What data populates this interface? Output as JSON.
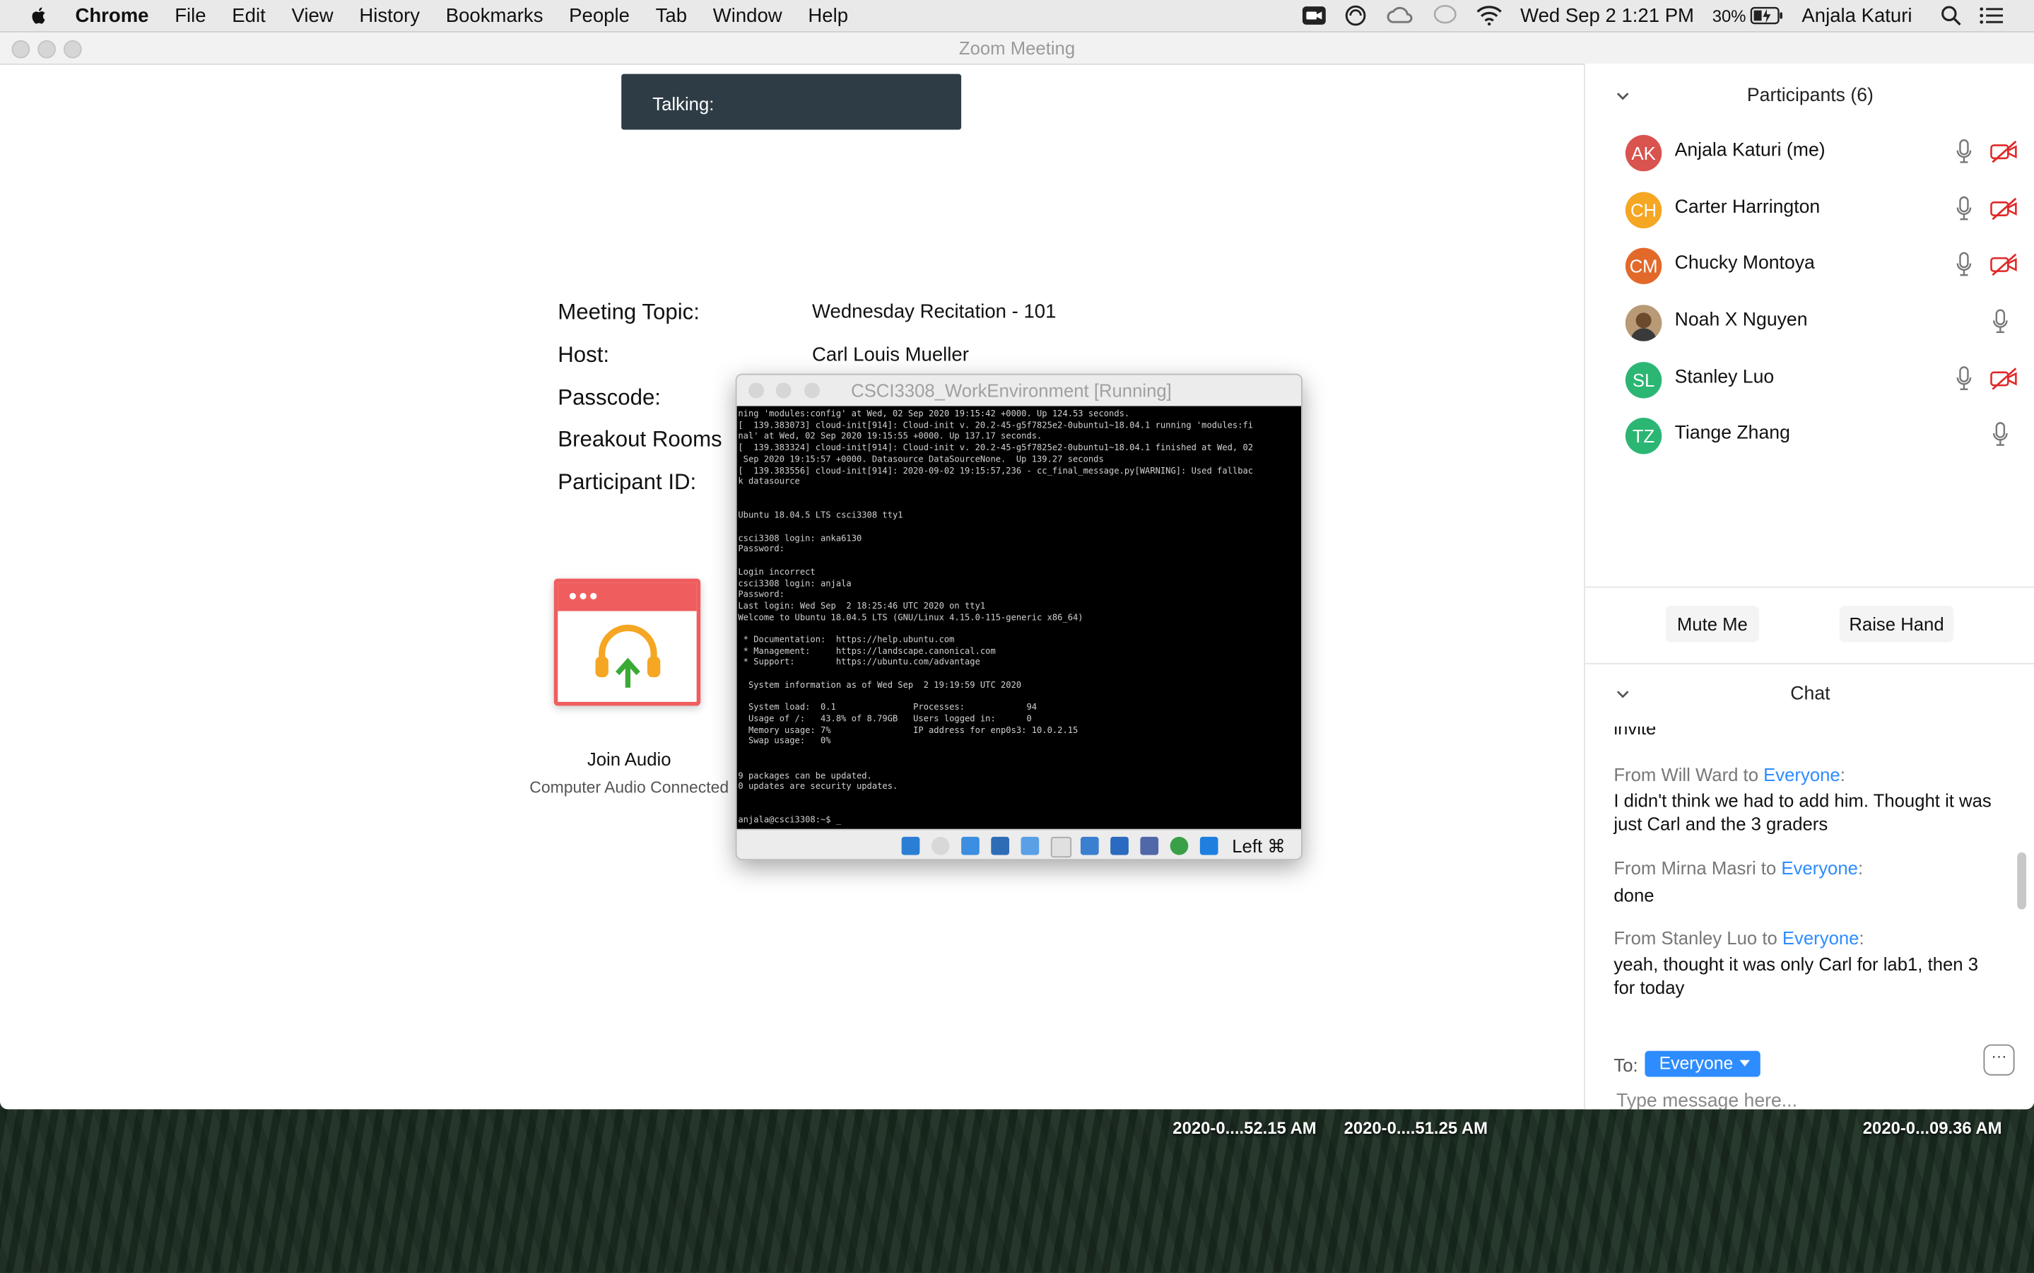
{
  "menubar": {
    "app": "Chrome",
    "items": [
      "File",
      "Edit",
      "View",
      "History",
      "Bookmarks",
      "People",
      "Tab",
      "Window",
      "Help"
    ],
    "datetime": "Wed Sep 2  1:21 PM",
    "battery": "30%",
    "user": "Anjala Katuri"
  },
  "window": {
    "title": "Zoom Meeting"
  },
  "talking": "Talking:",
  "meeting": {
    "topic_label": "Meeting Topic:",
    "topic": "Wednesday Recitation - 101",
    "host_label": "Host:",
    "host": "Carl Louis Mueller",
    "passcode_label": "Passcode:",
    "breakout_label": "Breakout Rooms",
    "participant_id_label": "Participant ID:"
  },
  "audio": {
    "join": "Join Audio",
    "status": "Computer Audio Connected"
  },
  "vbox": {
    "title": "CSCI3308_WorkEnvironment [Running]",
    "host_key": "Left ⌘",
    "terminal": "ning 'modules:config' at Wed, 02 Sep 2020 19:15:42 +0000. Up 124.53 seconds.\n[  139.383073] cloud-init[914]: Cloud-init v. 20.2-45-g5f7825e2-0ubuntu1~18.04.1 running 'modules:fi\nnal' at Wed, 02 Sep 2020 19:15:55 +0000. Up 137.17 seconds.\n[  139.383324] cloud-init[914]: Cloud-init v. 20.2-45-g5f7825e2-0ubuntu1~18.04.1 finished at Wed, 02\n Sep 2020 19:15:57 +0000. Datasource DataSourceNone.  Up 139.27 seconds\n[  139.383556] cloud-init[914]: 2020-09-02 19:15:57,236 - cc_final_message.py[WARNING]: Used fallbac\nk datasource\n\n\nUbuntu 18.04.5 LTS csci3308 tty1\n\ncsci3308 login: anka6130\nPassword:\n\nLogin incorrect\ncsci3308 login: anjala\nPassword:\nLast login: Wed Sep  2 18:25:46 UTC 2020 on tty1\nWelcome to Ubuntu 18.04.5 LTS (GNU/Linux 4.15.0-115-generic x86_64)\n\n * Documentation:  https://help.ubuntu.com\n * Management:     https://landscape.canonical.com\n * Support:        https://ubuntu.com/advantage\n\n  System information as of Wed Sep  2 19:19:59 UTC 2020\n\n  System load:  0.1               Processes:            94\n  Usage of /:   43.8% of 8.79GB   Users logged in:      0\n  Memory usage: 7%                IP address for enp0s3: 10.0.2.15\n  Swap usage:   0%\n\n\n9 packages can be updated.\n0 updates are security updates.\n\n\nanjala@csci3308:~$ _"
  },
  "participants": {
    "header": "Participants (6)",
    "list": [
      {
        "initials": "AK",
        "name": "Anjala Katuri (me)",
        "color": "#d9534f",
        "mic": true,
        "video_off": true
      },
      {
        "initials": "CH",
        "name": "Carter Harrington",
        "color": "#f5a623",
        "mic": true,
        "video_off": true
      },
      {
        "initials": "CM",
        "name": "Chucky Montoya",
        "color": "#e2692a",
        "mic": true,
        "video_off": true
      },
      {
        "initials": "",
        "name": "Noah X Nguyen",
        "color": "#8a6a4a",
        "mic": true,
        "video_off": false
      },
      {
        "initials": "SL",
        "name": "Stanley Luo",
        "color": "#2bb673",
        "mic": true,
        "video_off": true
      },
      {
        "initials": "TZ",
        "name": "Tiange Zhang",
        "color": "#2bb673",
        "mic": true,
        "video_off": false
      }
    ],
    "mute_me": "Mute Me",
    "raise_hand": "Raise Hand"
  },
  "chat": {
    "header": "Chat",
    "partial_top": "invite",
    "messages": [
      {
        "from": "From Will Ward to ",
        "to": "Everyone",
        "text": "I didn't think we had to add him. Thought it was just Carl and the 3 graders"
      },
      {
        "from": "From Mirna Masri to ",
        "to": "Everyone",
        "text": "done"
      },
      {
        "from": "From Stanley Luo to ",
        "to": "Everyone",
        "text": "yeah, thought it was only Carl for lab1, then 3 for today"
      }
    ],
    "to_label": "To:",
    "to_value": "Everyone",
    "more": "···",
    "placeholder": "Type message here..."
  },
  "desktop_files": [
    "2020-0....52.15 AM",
    "2020-0....51.25 AM",
    "2020-0...09.36 AM"
  ]
}
